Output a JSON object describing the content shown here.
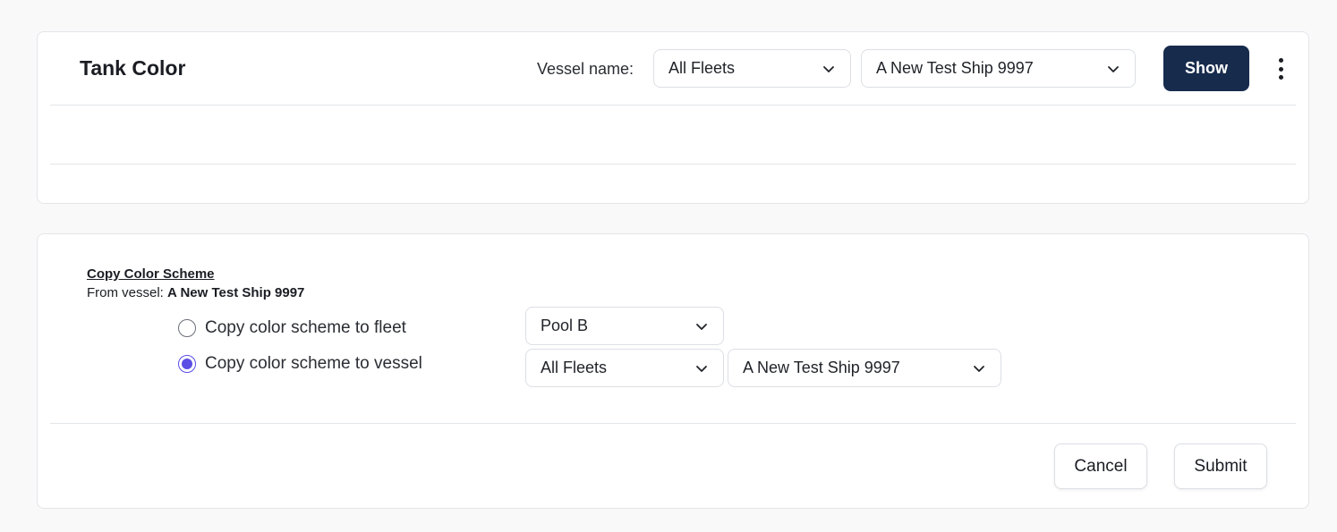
{
  "header": {
    "title": "Tank Color",
    "vessel_label": "Vessel name:",
    "fleet_select": "All Fleets",
    "ship_select": "A New Test Ship 9997",
    "show_button": "Show",
    "more_icon": "kebab-menu-icon"
  },
  "copy_scheme": {
    "heading": "Copy Color Scheme",
    "from_prefix": "From vessel: ",
    "from_vessel": "A New Test Ship 9997",
    "options": [
      {
        "label": "Copy color scheme to fleet",
        "checked": false
      },
      {
        "label": "Copy color scheme to vessel",
        "checked": true
      }
    ],
    "pool_select": "Pool B",
    "fleet_select": "All Fleets",
    "ship_select": "A New Test Ship 9997"
  },
  "actions": {
    "cancel": "Cancel",
    "submit": "Submit"
  },
  "colors": {
    "primary": "#172b4d",
    "radio_accent": "#5b4ee5",
    "border": "#e3e5e9"
  }
}
